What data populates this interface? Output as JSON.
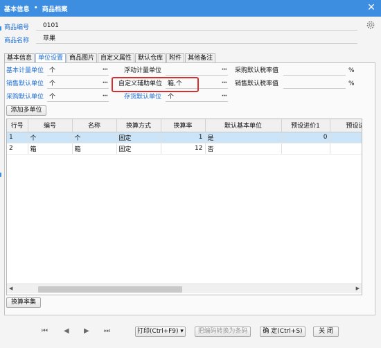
{
  "window": {
    "title_left": "基本信息",
    "title_sep": "•",
    "title_right": "商品档案",
    "close_glyph": "✕"
  },
  "header": {
    "code_label": "商品编号",
    "code_value": "0101",
    "name_label": "商品名称",
    "name_value": "苹果"
  },
  "tabs": [
    "基本信息",
    "单位设置",
    "商品图片",
    "自定义属性",
    "默认仓库",
    "附件",
    "其他备注"
  ],
  "fields": {
    "base_unit_label": "基本计量单位",
    "base_unit_value": "个",
    "float_unit_label": "浮动计量单位",
    "float_unit_value": "",
    "purchase_tax_label": "采购默认税率值",
    "purchase_tax_value": "",
    "purchase_tax_unit": "%",
    "sales_unit_label": "销售默认单位",
    "sales_unit_value": "个",
    "custom_aux_label": "自定义辅助单位",
    "custom_aux_value": "箱,个",
    "sales_tax_label": "销售默认税率值",
    "sales_tax_value": "",
    "sales_tax_unit": "%",
    "purchase_unit_label": "采购默认单位",
    "purchase_unit_value": "个",
    "stock_unit_label": "存货默认单位",
    "stock_unit_value": "个",
    "dots": "···"
  },
  "add_multi_unit": "添加多单位",
  "table": {
    "columns": [
      "行号",
      "编号",
      "名称",
      "换算方式",
      "换算率",
      "默认基本单位",
      "预设进价1",
      "预设进"
    ],
    "rows": [
      {
        "no": "1",
        "code": "个",
        "name": "个",
        "method": "固定",
        "rate": "1",
        "default_base": "是",
        "price1": "0",
        "price2": ""
      },
      {
        "no": "2",
        "code": "箱",
        "name": "箱",
        "method": "固定",
        "rate": "12",
        "default_base": "否",
        "price1": "",
        "price2": ""
      }
    ]
  },
  "conversion_set": "换算率集",
  "footer": {
    "first": "⏮",
    "prev": "◀",
    "next": "▶",
    "last": "⏭",
    "print": "打印(Ctrl+F9)",
    "print_arrow": "▾",
    "barcode": "把编码转换为条码",
    "ok": "确 定(Ctrl+S)",
    "close": "关 闭"
  },
  "colors": {
    "title_bar": "#3d8de1",
    "label_blue": "#1d6fd6",
    "highlight_box": "#d6302e",
    "selected_row": "#cce4f7"
  }
}
